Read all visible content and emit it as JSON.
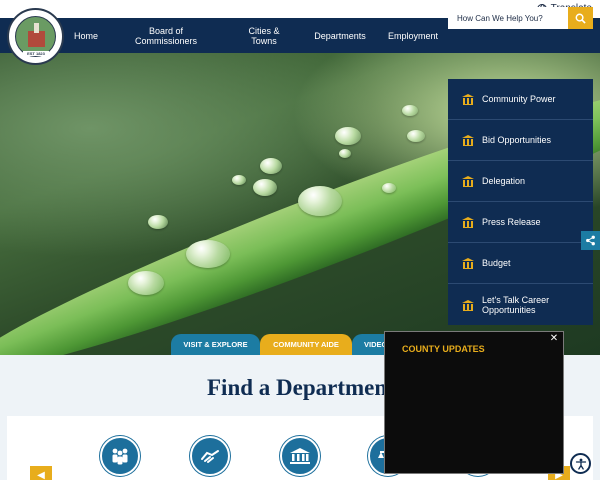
{
  "utility": {
    "translate_label": "Translate",
    "translate_icon": "globe-icon"
  },
  "logo": {
    "text": "EST 1823",
    "icon": "county-seal-icon"
  },
  "nav": {
    "items": [
      {
        "label": "Home"
      },
      {
        "label": "Board of Commissioners"
      },
      {
        "label": "Cities & Towns"
      },
      {
        "label": "Departments"
      },
      {
        "label": "Employment"
      }
    ],
    "search": {
      "placeholder": "How Can We Help You?",
      "icon": "search-icon"
    }
  },
  "quick_links": {
    "icon": "government-building-icon",
    "items": [
      {
        "label": "Community Power"
      },
      {
        "label": "Bid Opportunities"
      },
      {
        "label": "Delegation"
      },
      {
        "label": "Press Release"
      },
      {
        "label": "Budget"
      },
      {
        "label": "Let's Talk Career Opportunities"
      }
    ]
  },
  "share": {
    "icon": "share-icon"
  },
  "hero_tabs": [
    {
      "label": "VISIT & EXPLORE",
      "color": "#1c7ca3"
    },
    {
      "label": "COMMUNITY AIDE",
      "color": "#e8ad1c"
    },
    {
      "label": "VIDEO",
      "color": "#1c7ca3"
    }
  ],
  "departments": {
    "title": "Find a Department",
    "icons": [
      "community-icon",
      "handshake-icon",
      "courthouse-icon",
      "justice-icon",
      "building-icon"
    ],
    "prev_icon": "arrow-left-icon",
    "next_icon": "arrow-right-icon"
  },
  "updates_popup": {
    "title": "COUNTY UPDATES",
    "close_icon": "close-icon"
  },
  "accessibility": {
    "icon": "accessibility-icon"
  },
  "colors": {
    "navy": "#0f2c52",
    "gold": "#e8ad1c",
    "teal": "#1c7ca3"
  }
}
